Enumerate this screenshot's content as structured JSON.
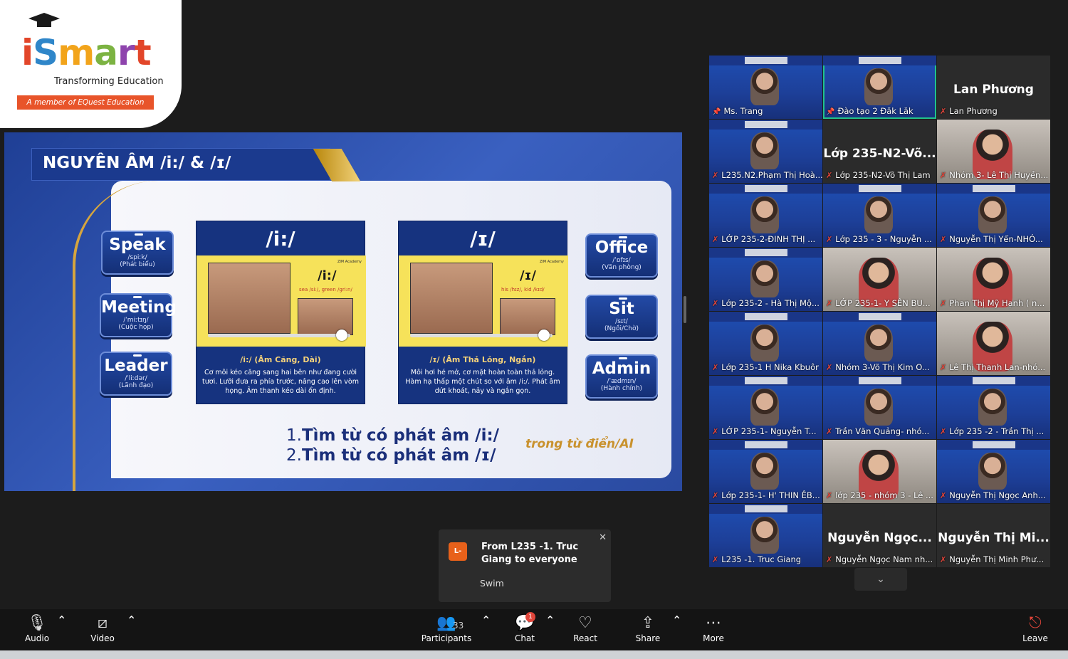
{
  "logo": {
    "brand": "iSmart",
    "tagline": "Transforming Education",
    "member": "A member of EQuest Education"
  },
  "slide": {
    "title": "NGUYÊN ÂM /i:/ & /ɪ/",
    "left_words": [
      {
        "word": "Speak",
        "ipa": "/spiːk/",
        "meaning": "(Phát biểu)"
      },
      {
        "word": "Meeting",
        "ipa": "/ˈmiːtɪŋ/",
        "meaning": "(Cuộc họp)"
      },
      {
        "word": "Leader",
        "ipa": "/ˈliːdər/",
        "meaning": "(Lãnh đạo)"
      }
    ],
    "right_words": [
      {
        "word": "Office",
        "ipa": "/ˈɒfɪs/",
        "meaning": "(Văn phòng)"
      },
      {
        "word": "Sit",
        "ipa": "/sɪt/",
        "meaning": "(Ngồi/Chờ)"
      },
      {
        "word": "Admin",
        "ipa": "/ˈædmɪn/",
        "meaning": "(Hành chính)"
      }
    ],
    "cards": [
      {
        "symbol": "/i:/",
        "ipa": "/i:/",
        "examples": "sea /si:/, green /gri:n/",
        "brand": "ZIM Academy",
        "heading": "/i:/ (Âm Căng, Dài)",
        "desc": "Cơ môi kéo căng sang hai bên như đang cười tươi. Lưỡi đưa ra phía trước, nâng cao lên vòm họng. Âm thanh kéo dài ổn định."
      },
      {
        "symbol": "/ɪ/",
        "ipa": "/ɪ/",
        "examples": "his /hɪz/, kid /kɪd/",
        "brand": "ZIM Academy",
        "heading": "/ɪ/ (Âm Thả Lỏng, Ngắn)",
        "desc": "Môi hơi hé mở, cơ mặt hoàn toàn thả lỏng. Hàm hạ thấp một chút so với âm /i:/. Phát âm dứt khoát, nảy và ngắn gọn."
      }
    ],
    "task1_num": "1.",
    "task1": "Tìm từ có phát âm /i:/",
    "task2_num": "2.",
    "task2": "Tìm từ có phát âm /ɪ/",
    "hint": "trong từ điển/AI"
  },
  "gallery": {
    "tiles": [
      {
        "name": "Ms. Trang",
        "type": "video",
        "pinned": true
      },
      {
        "name": "Đào tạo 2 Đăk Lăk",
        "type": "video",
        "pinned": true,
        "active": true
      },
      {
        "name": "Lan Phương",
        "type": "blank",
        "big": "Lan Phương"
      },
      {
        "name": "L235.N2.Phạm Thị Hoà...",
        "type": "video"
      },
      {
        "name": "Lớp 235-N2-Võ Thị Lam",
        "type": "blank",
        "big": "Lớp 235-N2-Võ..."
      },
      {
        "name": "Nhóm 3- Lê Thị Huyền...",
        "type": "cam"
      },
      {
        "name": "LỚP 235-2-ĐINH THỊ ...",
        "type": "video"
      },
      {
        "name": "Lớp 235 - 3 - Nguyễn ...",
        "type": "video"
      },
      {
        "name": "Nguyễn Thị Yến-NHÓ...",
        "type": "video"
      },
      {
        "name": "Lớp 235-2 - Hà Thị Mộ...",
        "type": "video"
      },
      {
        "name": "LỚP 235-1- Y SÊN BU...",
        "type": "cam"
      },
      {
        "name": "Phan Thị Mỹ Hạnh ( n...",
        "type": "cam"
      },
      {
        "name": "Lớp 235-1 H Nika Kbuôr",
        "type": "video"
      },
      {
        "name": "Nhóm 3-Võ Thị Kim O...",
        "type": "video"
      },
      {
        "name": "Lê Thị Thanh Lan-nhó...",
        "type": "cam"
      },
      {
        "name": "LỚP 235-1- Nguyễn T...",
        "type": "video"
      },
      {
        "name": "Trần Văn Quảng- nhó...",
        "type": "video"
      },
      {
        "name": "Lớp 235 -2 - Trần Thị ...",
        "type": "video"
      },
      {
        "name": "Lớp 235-1- H' THIN ÊB...",
        "type": "video"
      },
      {
        "name": "lớp 235 - nhóm 3 - Lê ...",
        "type": "cam"
      },
      {
        "name": "Nguyễn Thị Ngọc Anh...",
        "type": "video"
      },
      {
        "name": "L235 -1. Truc Giang",
        "type": "video"
      },
      {
        "name": "Nguyễn Ngọc Nam nh...",
        "type": "blank",
        "big": "Nguyễn Ngọc..."
      },
      {
        "name": "Nguyễn Thị Minh Phư...",
        "type": "blank",
        "big": "Nguyễn Thị Mi..."
      }
    ]
  },
  "toast": {
    "avatar": "L-",
    "from": "From L235 -1. Truc Giang to everyone",
    "message": "Swim"
  },
  "toolbar": {
    "audio": "Audio",
    "video": "Video",
    "participants": "Participants",
    "participants_count": "33",
    "chat": "Chat",
    "chat_badge": "1",
    "react": "React",
    "share": "Share",
    "more": "More",
    "leave": "Leave"
  }
}
